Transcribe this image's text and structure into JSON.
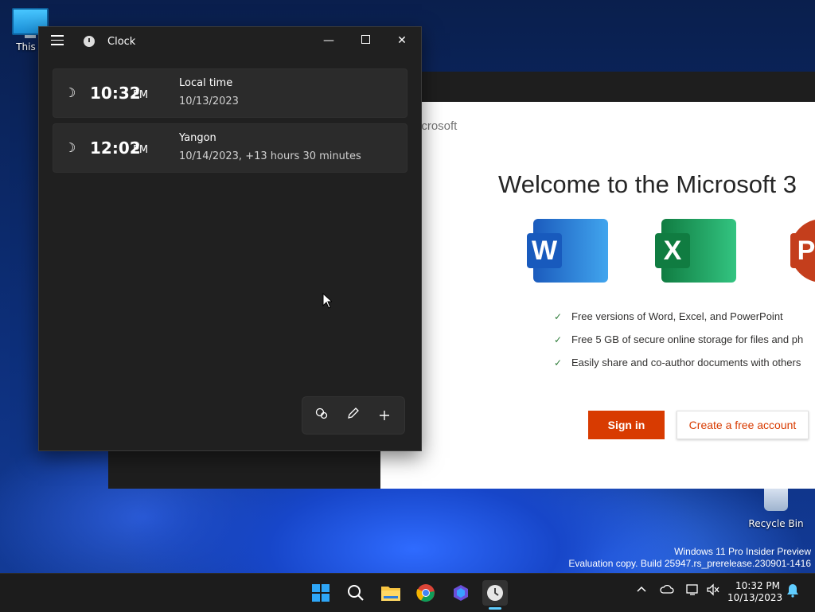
{
  "desktop": {
    "this_pc_label": "This P",
    "recycle_bin_label": "Recycle Bin"
  },
  "clock_app": {
    "title": "Clock",
    "clocks": [
      {
        "time": "10:32",
        "ampm": "PM",
        "city": "Local time",
        "subtext": "10/13/2023"
      },
      {
        "time": "12:02",
        "ampm": "PM",
        "city": "Yangon",
        "subtext": "10/14/2023, +13 hours 30 minutes"
      }
    ]
  },
  "office_window": {
    "brand": "icrosoft",
    "heading": "Welcome to the Microsoft 3",
    "apps": [
      "W",
      "X",
      "P"
    ],
    "features": [
      "Free versions of Word, Excel, and PowerPoint",
      "Free 5 GB of secure online storage for files and ph",
      "Easily share and co-author documents with others"
    ],
    "sign_in_label": "Sign in",
    "create_account_label": "Create a free account"
  },
  "watermark": {
    "line1": "Windows 11 Pro Insider Preview",
    "line2": "Evaluation copy. Build 25947.rs_prerelease.230901-1416"
  },
  "taskbar": {
    "time": "10:32 PM",
    "date": "10/13/2023"
  },
  "colors": {
    "office_accent": "#d83b01",
    "taskbar_indicator": "#60cdff"
  }
}
